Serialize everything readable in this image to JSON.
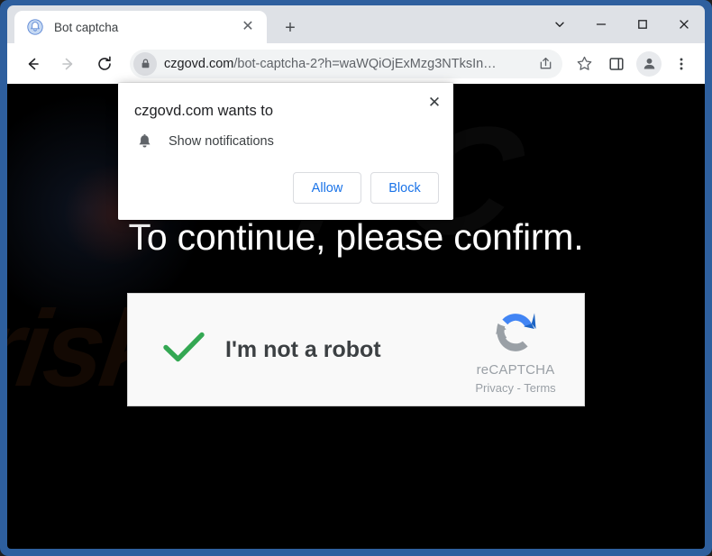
{
  "window": {
    "controls": {
      "tab_search": "tab-search-chevron",
      "minimize": "minimize",
      "maximize": "maximize",
      "close": "close"
    }
  },
  "tabstrip": {
    "tabs": [
      {
        "title": "Bot captcha",
        "favicon": "bell-favicon",
        "close_label": "✕"
      }
    ],
    "new_tab_label": "+"
  },
  "toolbar": {
    "back_label": "back-arrow-icon",
    "forward_label": "forward-arrow-icon",
    "reload_label": "reload-icon",
    "omnibox": {
      "lock_icon": "lock-icon",
      "host": "czgovd.com",
      "path": "/bot-captcha-2?h=waWQiOjExMzg3NTksIn…",
      "full_url": "czgovd.com/bot-captcha-2?h=waWQiOjExMzg3NTksIn…",
      "share_icon": "share-icon"
    },
    "bookmark_icon": "star-icon",
    "sidepanel_icon": "side-panel-icon",
    "profile_icon": "profile-avatar-icon",
    "menu_icon": "three-dot-menu-icon"
  },
  "permission_bubble": {
    "title": "czgovd.com wants to",
    "permission_icon": "bell-icon",
    "permission_text": "Show notifications",
    "allow_label": "Allow",
    "block_label": "Block",
    "close_label": "✕",
    "link_color": "#1a73e8"
  },
  "page": {
    "headline": "To continue, please confirm.",
    "background_color": "#000000",
    "watermark_text": "risk.com",
    "watermark_text_2": "PC",
    "recaptcha": {
      "checkmark_icon": "green-checkmark-icon",
      "label": "I'm not a robot",
      "logo_icon": "recaptcha-logo-icon",
      "brand": "reCAPTCHA",
      "privacy_label": "Privacy",
      "separator": "-",
      "terms_label": "Terms",
      "privacy_terms": "Privacy - Terms",
      "check_color": "#34a853",
      "logo_blue": "#1c64c4",
      "logo_gray": "#9aa0a6"
    }
  }
}
